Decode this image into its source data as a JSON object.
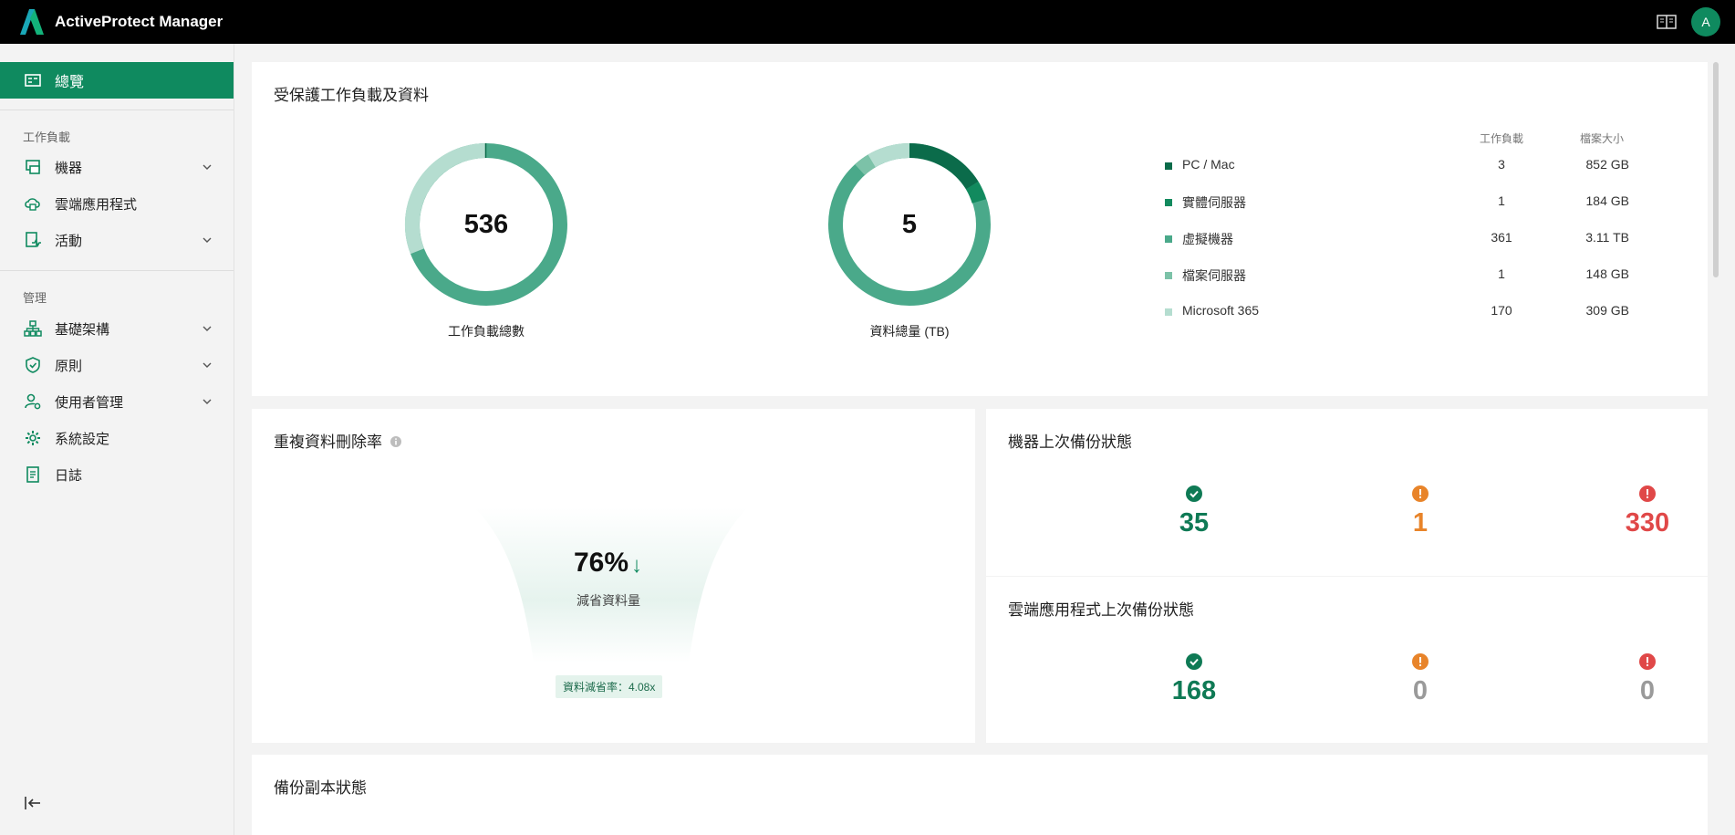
{
  "header": {
    "app_title": "ActiveProtect Manager",
    "avatar_initial": "A"
  },
  "sidebar": {
    "active_item": "總覽",
    "section_workload": "工作負載",
    "machines": "機器",
    "cloud_apps": "雲端應用程式",
    "activities": "活動",
    "section_manage": "管理",
    "infrastructure": "基礎架構",
    "policies": "原則",
    "user_management": "使用者管理",
    "system_settings": "系統設定",
    "logs": "日誌"
  },
  "protected": {
    "title": "受保護工作負載及資料",
    "workload_total": "536",
    "workload_caption": "工作負載總數",
    "data_total": "5",
    "data_caption": "資料總量 (TB)",
    "col_workload": "工作負載",
    "col_size": "檔案大小",
    "rows": [
      {
        "name": "PC / Mac",
        "count": "3",
        "size": "852 GB",
        "color": "#0b6b4a"
      },
      {
        "name": "實體伺服器",
        "count": "1",
        "size": "184 GB",
        "color": "#128a5e"
      },
      {
        "name": "虛擬機器",
        "count": "361",
        "size": "3.11 TB",
        "color": "#4aa98a"
      },
      {
        "name": "檔案伺服器",
        "count": "1",
        "size": "148 GB",
        "color": "#7cc2a8"
      },
      {
        "name": "Microsoft 365",
        "count": "170",
        "size": "309 GB",
        "color": "#b5ddd0"
      }
    ]
  },
  "dedup": {
    "title": "重複資料刪除率",
    "percent": "76%",
    "saved_label": "減省資料量",
    "rate_label": "資料減省率：4.08x"
  },
  "machine_backup": {
    "title": "機器上次備份狀態",
    "success": "35",
    "warning": "1",
    "error": "330"
  },
  "cloud_backup": {
    "title": "雲端應用程式上次備份狀態",
    "success": "168",
    "warning": "0",
    "error": "0"
  },
  "copy_status": {
    "title": "備份副本狀態"
  },
  "colors": {
    "accent": "#0f8a5f",
    "warning": "#e8842a",
    "error": "#e04848"
  }
}
